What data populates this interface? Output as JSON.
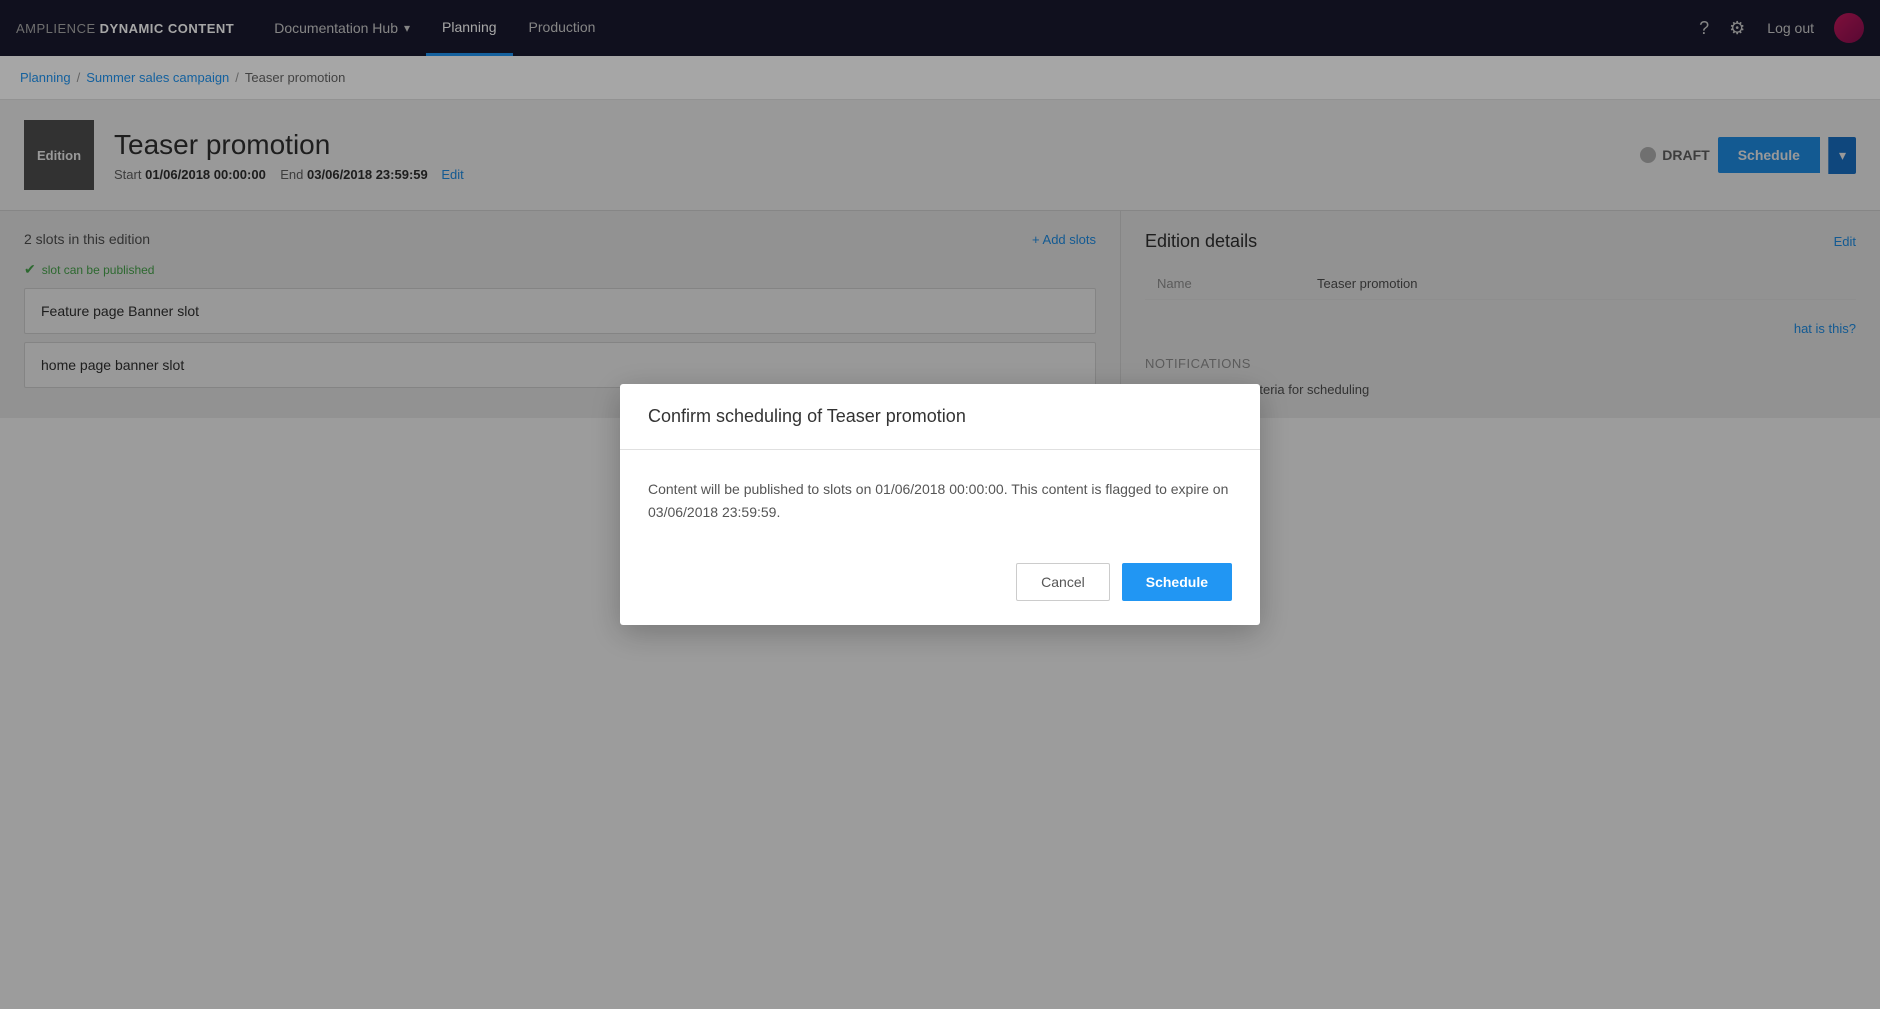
{
  "brand": {
    "amplience": "AMPLIENCE",
    "dc": "DYNAMIC CONTENT"
  },
  "nav": {
    "doc_hub_label": "Documentation Hub",
    "planning_label": "Planning",
    "production_label": "Production",
    "help_icon": "?",
    "settings_icon": "⚙",
    "logout_label": "Log out"
  },
  "breadcrumb": {
    "planning": "Planning",
    "campaign": "Summer sales campaign",
    "current": "Teaser promotion",
    "sep": "/"
  },
  "page_header": {
    "edition_badge": "Edition",
    "title": "Teaser promotion",
    "start_label": "Start",
    "start_value": "01/06/2018 00:00:00",
    "end_label": "End",
    "end_value": "03/06/2018 23:59:59",
    "edit_label": "Edit",
    "draft_label": "DRAFT",
    "schedule_label": "Schedule"
  },
  "slots": {
    "count_label": "2 slots in this edition",
    "add_slots_label": "+ Add slots",
    "publishable_label": "slot can be published",
    "items": [
      {
        "name": "Feature page Banner slot"
      },
      {
        "name": "home page banner slot"
      }
    ]
  },
  "edition_details": {
    "title": "Edition details",
    "edit_label": "Edit",
    "name_label": "Name",
    "name_value": "Teaser promotion",
    "what_is_this_label": "hat is this?",
    "notifications_title": "Notifications",
    "notifications_item": "All slots meet criteria for scheduling"
  },
  "modal": {
    "title": "Confirm scheduling of Teaser promotion",
    "body": "Content will be published to slots on 01/06/2018 00:00:00. This content is flagged to expire on 03/06/2018 23:59:59.",
    "cancel_label": "Cancel",
    "schedule_label": "Schedule"
  }
}
